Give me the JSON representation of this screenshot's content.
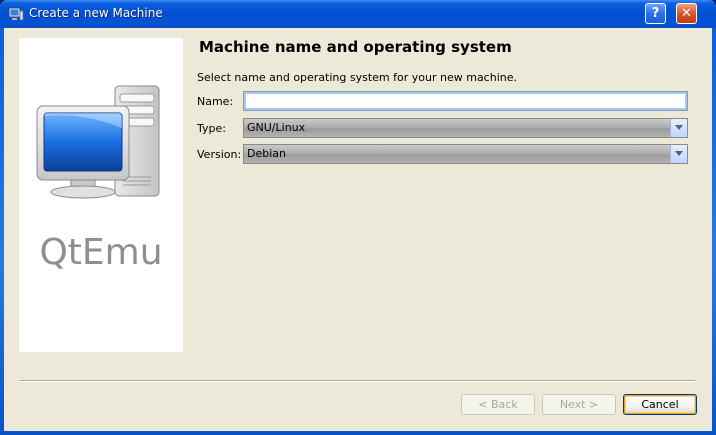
{
  "window": {
    "title": "Create a new Machine",
    "help_button": "?",
    "close_button": "✕"
  },
  "side_panel": {
    "brand": "QtEmu"
  },
  "page": {
    "title": "Machine name and operating system",
    "subtitle": "Select name and operating system for your new machine."
  },
  "form": {
    "name_label": "Name:",
    "name_value": "",
    "type_label": "Type:",
    "type_value": "GNU/Linux",
    "version_label": "Version:",
    "version_value": "Debian"
  },
  "buttons": {
    "back": "< Back",
    "next": "Next >",
    "cancel": "Cancel"
  }
}
